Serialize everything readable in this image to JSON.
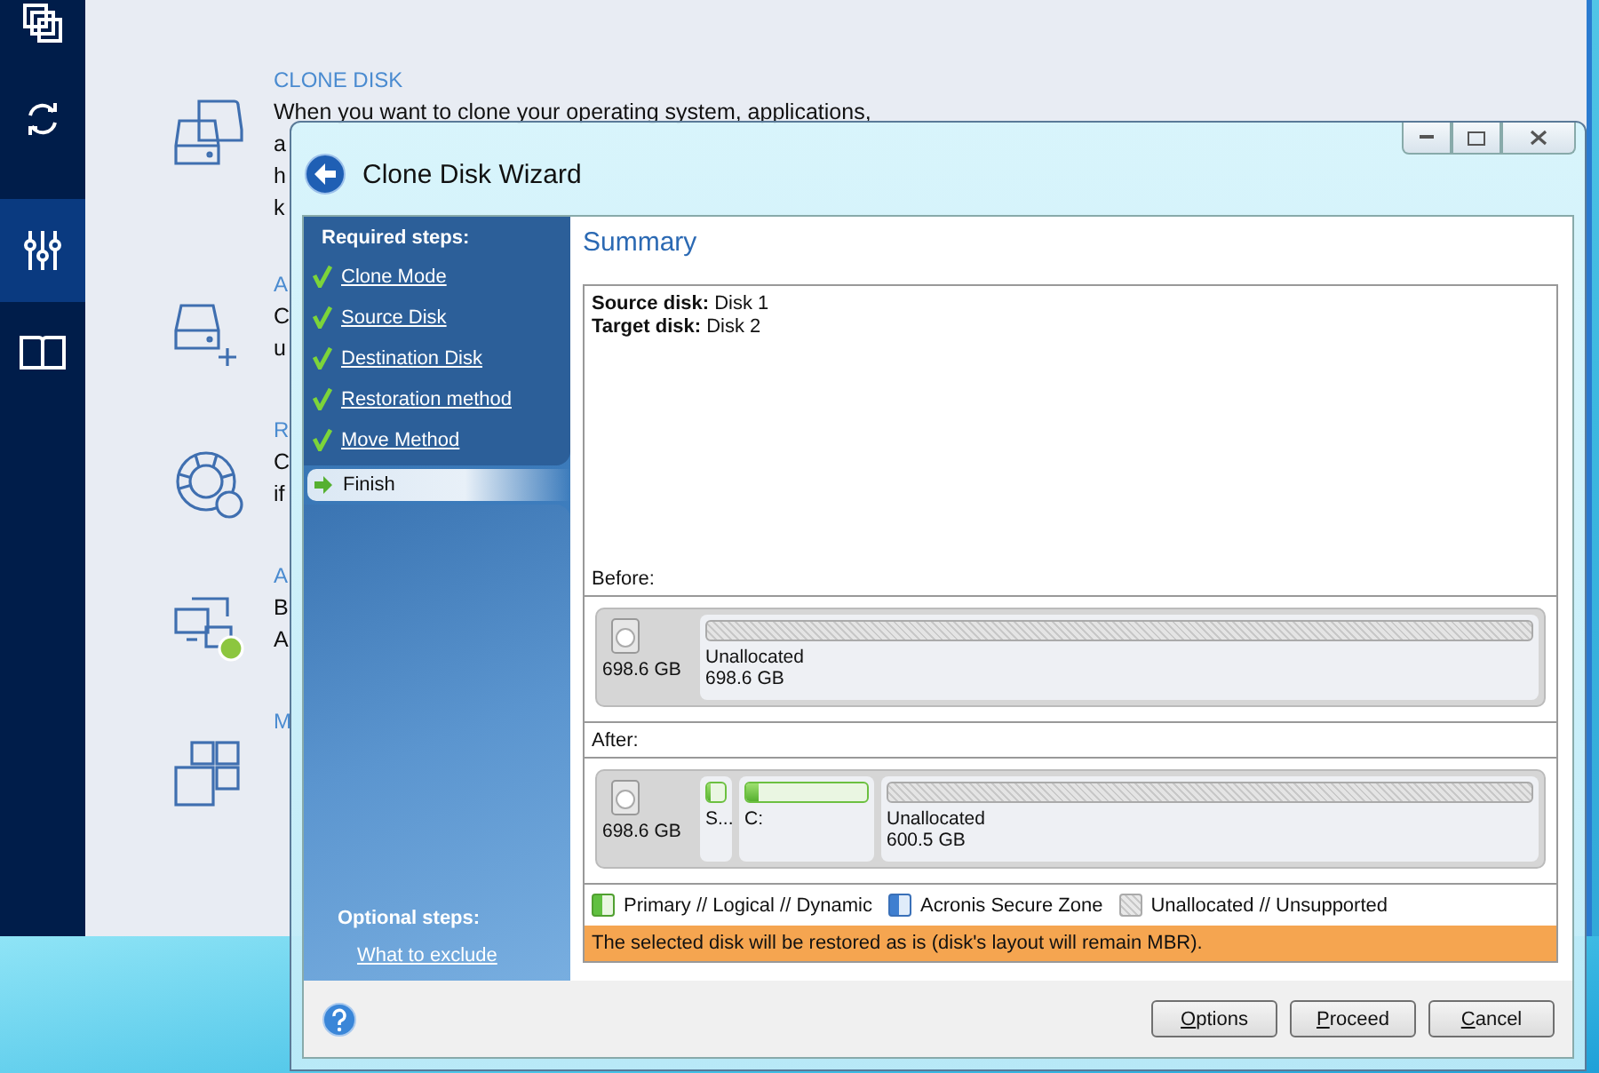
{
  "sidebar": {
    "items": [
      {
        "selected": false
      },
      {
        "selected": false
      },
      {
        "selected": true
      },
      {
        "selected": false
      }
    ]
  },
  "tools": [
    {
      "title": "CLONE DISK",
      "lines": [
        "When you want to clone your operating system, applications,",
        "a",
        "h",
        "k"
      ]
    },
    {
      "title": "A",
      "lines": [
        "C",
        "u"
      ]
    },
    {
      "title": "R",
      "lines": [
        "C",
        "if"
      ]
    },
    {
      "title": "A",
      "lines": [
        "B",
        "A"
      ]
    },
    {
      "title": "M"
    }
  ],
  "dialog": {
    "title": "Clone Disk Wizard",
    "required_heading": "Required steps:",
    "steps": [
      {
        "label": "Clone Mode",
        "completed": true,
        "selected": false
      },
      {
        "label": "Source Disk",
        "completed": true,
        "selected": false
      },
      {
        "label": "Destination Disk",
        "completed": true,
        "selected": false
      },
      {
        "label": "Restoration method",
        "completed": true,
        "selected": false
      },
      {
        "label": "Move Method",
        "completed": true,
        "selected": false
      },
      {
        "label": "Finish",
        "completed": false,
        "selected": true
      }
    ],
    "optional_heading": "Optional steps:",
    "optional_steps": [
      {
        "label": "What to exclude"
      }
    ],
    "summary": {
      "heading": "Summary",
      "fields": [
        {
          "label": "Source disk:",
          "value": "Disk 1"
        },
        {
          "label": "Target disk:",
          "value": "Disk 2"
        }
      ],
      "layouts": [
        {
          "label": "Before:",
          "disk_size": "698.6 GB",
          "partitions": [
            {
              "kind": "unallocated",
              "label": "Unallocated",
              "size": "698.6 GB"
            }
          ]
        },
        {
          "label": "After:",
          "disk_size": "698.6 GB",
          "partitions": [
            {
              "kind": "primary",
              "label": "S...",
              "level": 0.15
            },
            {
              "kind": "primary",
              "label": "C:",
              "level": 0.1
            },
            {
              "kind": "unallocated",
              "label": "Unallocated",
              "size": "600.5 GB"
            }
          ]
        }
      ],
      "legend": [
        {
          "kind": "primary",
          "label": "Primary // Logical // Dynamic"
        },
        {
          "kind": "secure_zone",
          "label": "Acronis Secure Zone"
        },
        {
          "kind": "unallocated",
          "label": "Unallocated // Unsupported"
        }
      ],
      "notice": "The selected disk will be restored as is (disk's layout will remain MBR)."
    },
    "buttons": [
      "Options",
      "Proceed",
      "Cancel"
    ]
  }
}
